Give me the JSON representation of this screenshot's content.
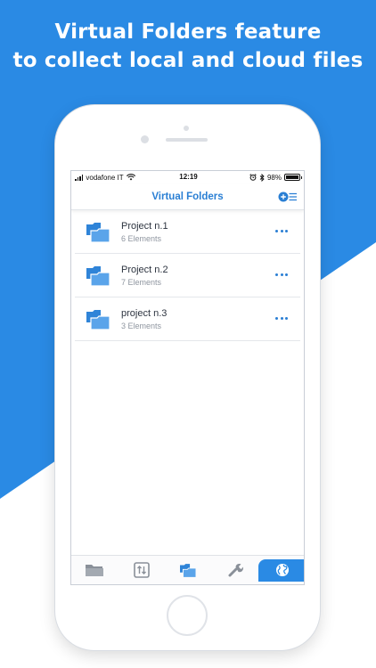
{
  "headline": {
    "line1": "Virtual Folders feature",
    "line2": "to collect local and cloud files"
  },
  "colors": {
    "background_blue": "#2a8ae4",
    "accent_blue": "#2a7fd4",
    "folder_icon_blue": "#2f84d8"
  },
  "status_bar": {
    "carrier": "vodafone IT",
    "time": "12:19",
    "battery": "98%",
    "battery_level": 0.98,
    "icons": [
      "signal-icon",
      "wifi-icon",
      "alarm-icon",
      "bluetooth-icon",
      "battery-icon"
    ]
  },
  "nav": {
    "title": "Virtual Folders",
    "add_icon": "add-list-icon"
  },
  "folders": [
    {
      "name": "Project n.1",
      "count": "6 Elements",
      "icon": "virtual-folder-icon",
      "menu_icon": "more-icon"
    },
    {
      "name": "Project n.2",
      "count": "7 Elements",
      "icon": "virtual-folder-icon",
      "menu_icon": "more-icon"
    },
    {
      "name": "project n.3",
      "count": "3 Elements",
      "icon": "virtual-folder-icon",
      "menu_icon": "more-icon"
    }
  ],
  "tab_bar": {
    "tabs": [
      {
        "icon": "folder-icon",
        "selected": false
      },
      {
        "icon": "transfer-icon",
        "selected": false
      },
      {
        "icon": "virtual-folders-icon",
        "selected": true
      },
      {
        "icon": "wrench-icon",
        "selected": false
      },
      {
        "icon": "globe-icon",
        "selected": false
      }
    ]
  }
}
